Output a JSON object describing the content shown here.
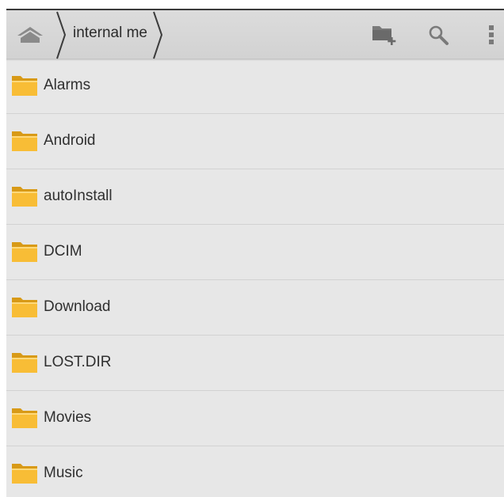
{
  "breadcrumb": {
    "current_label": "internal me"
  },
  "actions": {
    "new_folder_icon": "folder-plus-icon",
    "search_icon": "search-icon",
    "overflow_icon": "more-vertical-icon"
  },
  "colors": {
    "folder": "#f7b733",
    "toolbar": "#d6d6d6",
    "list_background": "#e7e7e7"
  },
  "files": [
    {
      "name": "Alarms"
    },
    {
      "name": "Android"
    },
    {
      "name": "autoInstall"
    },
    {
      "name": "DCIM"
    },
    {
      "name": "Download"
    },
    {
      "name": "LOST.DIR"
    },
    {
      "name": "Movies"
    },
    {
      "name": "Music"
    }
  ]
}
